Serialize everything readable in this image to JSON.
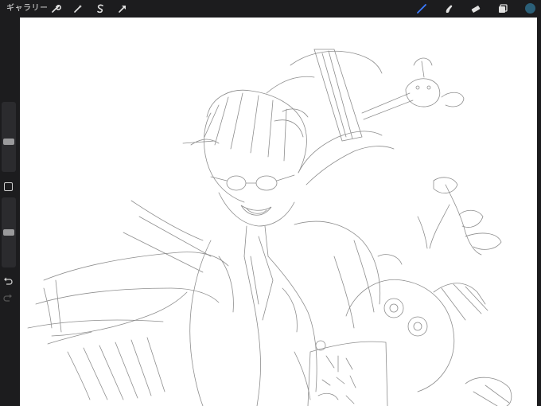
{
  "toolbar": {
    "gallery_label": "ギャラリー",
    "left_icons": [
      "wrench-icon",
      "magic-wand-icon",
      "selection-s-icon",
      "transform-arrow-icon"
    ],
    "right_icons": [
      "brush-icon",
      "smudge-icon",
      "eraser-icon",
      "layers-icon"
    ],
    "active_tool": "brush",
    "accent_color": "#3b7bff",
    "current_color": "#2b5f78"
  },
  "sidebar": {
    "brush_size_level": 0.42,
    "opacity_level": 0.5,
    "icons": [
      "modify-square-icon",
      "undo-icon",
      "redo-icon"
    ]
  },
  "canvas": {
    "background": "#ffffff",
    "sketch_color": "#7a7a7a"
  }
}
